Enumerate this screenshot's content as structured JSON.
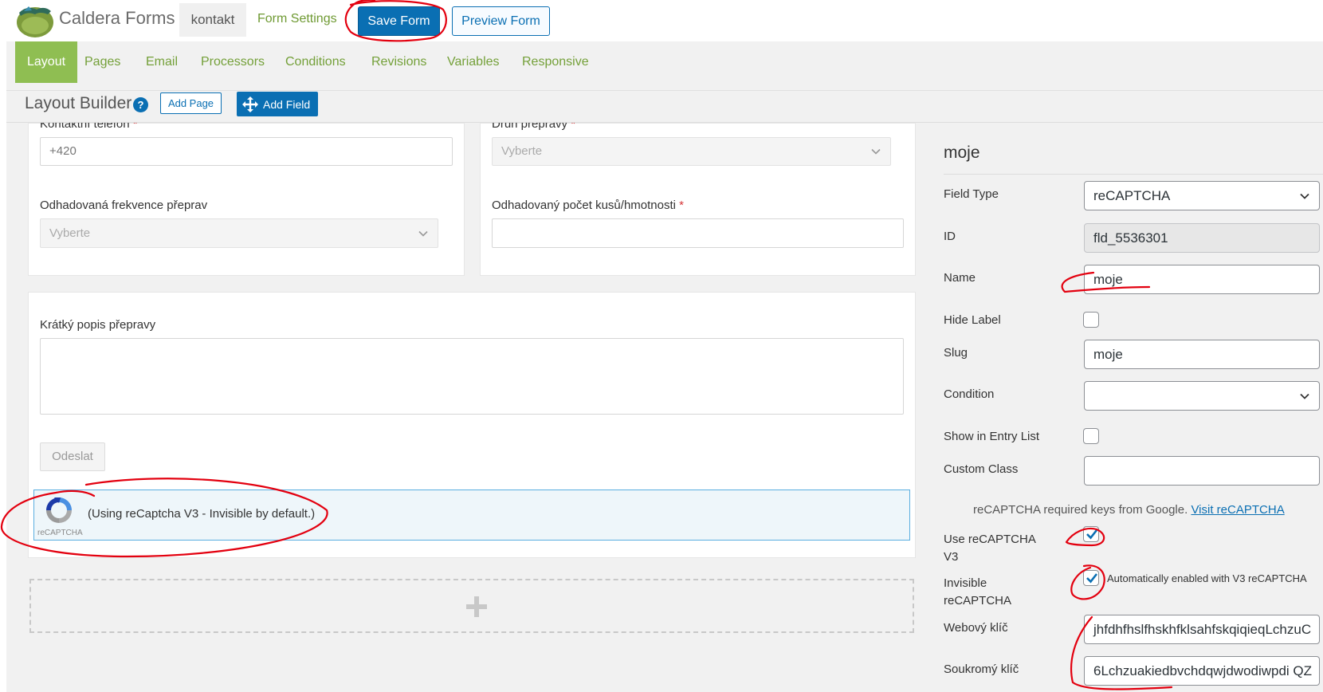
{
  "header": {
    "brand": "Caldera Forms",
    "form_tab": "kontakt",
    "form_settings": "Form Settings",
    "save_form": "Save Form",
    "preview_form": "Preview Form"
  },
  "nav": {
    "items": [
      "Layout",
      "Pages",
      "Email",
      "Processors",
      "Conditions",
      "Revisions",
      "Variables",
      "Responsive"
    ],
    "active": "Layout"
  },
  "toolbar": {
    "title": "Layout Builder",
    "help": "?",
    "add_page": "Add Page",
    "add_field": "Add Field"
  },
  "builder": {
    "phone_label": "Kontaktní telefon",
    "phone_placeholder": "+420",
    "transport_type_label": "Druh přepravy",
    "transport_type_value": "Vyberte",
    "frequency_label": "Odhadovaná frekvence přeprav",
    "frequency_value": "Vyberte",
    "pieces_label": "Odhadovaný počet kusů/hmotnosti",
    "required_mark": "*",
    "description_label": "Krátký popis přepravy",
    "submit_label": "Odeslat",
    "recaptcha_logo_text": "reCAPTCHA",
    "recaptcha_message": "(Using reCaptcha V3 - Invisible by default.)"
  },
  "settings": {
    "title": "moje",
    "field_type_label": "Field Type",
    "field_type_value": "reCAPTCHA",
    "id_label": "ID",
    "id_value": "fld_5536301",
    "name_label": "Name",
    "name_value": "moje",
    "hide_label_label": "Hide Label",
    "hide_label_checked": false,
    "slug_label": "Slug",
    "slug_value": "moje",
    "condition_label": "Condition",
    "condition_value": "",
    "show_in_entry_label": "Show in Entry List",
    "show_in_entry_checked": false,
    "custom_class_label": "Custom Class",
    "custom_class_value": "",
    "keys_note": "reCAPTCHA required keys from Google.",
    "keys_link": "Visit reCAPTCHA",
    "use_v3_label_line1": "Use reCAPTCHA",
    "use_v3_label_line2": "V3",
    "use_v3_checked": true,
    "invisible_label_line1": "Invisible",
    "invisible_label_line2": "reCAPTCHA",
    "invisible_checked": true,
    "invisible_note": "Automatically enabled with V3 reCAPTCHA",
    "site_key_label": "Webový klíč",
    "site_key_value": "jhfdhfhslfhskhfklsahfskqiqieqLchzuC",
    "secret_key_label": "Soukromý klíč",
    "secret_key_value": "6Lchzuakiedbvchdqwjdwodiwpdi QZ"
  },
  "colors": {
    "accent_green": "#8fbe52",
    "link_green": "#74a039",
    "primary_blue": "#0a6fb3",
    "annotation_red": "#e3000f"
  }
}
